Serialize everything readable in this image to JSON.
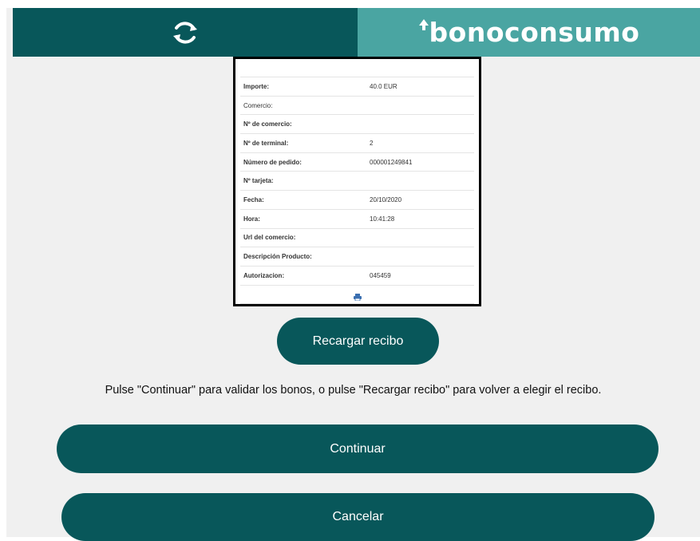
{
  "header": {
    "refresh_icon": "refresh-icon",
    "brand": "bonoconsumo",
    "colors": {
      "left": "#08575a",
      "right": "#4aa5a2"
    }
  },
  "receipt": {
    "rows": [
      {
        "label": "Importe:",
        "value": "40.0 EUR"
      },
      {
        "label": "Comercio:",
        "value": ""
      },
      {
        "label": "Nº de comercio:",
        "value": ""
      },
      {
        "label": "Nº de terminal:",
        "value": "2"
      },
      {
        "label": "Número de pedido:",
        "value": "000001249841"
      },
      {
        "label": "Nº tarjeta:",
        "value": ""
      },
      {
        "label": "Fecha:",
        "value": "20/10/2020"
      },
      {
        "label": "Hora:",
        "value": "10:41:28"
      },
      {
        "label": "Url del comercio:",
        "value": ""
      },
      {
        "label": "Descripción Producto:",
        "value": ""
      },
      {
        "label": "Autorizacion:",
        "value": "045459"
      }
    ],
    "print_icon": "printer-icon"
  },
  "buttons": {
    "reload": "Recargar recibo",
    "continue": "Continuar",
    "cancel": "Cancelar"
  },
  "instructions": "Pulse \"Continuar\" para validar los bonos, o pulse \"Recargar recibo\" para volver a elegir el recibo."
}
